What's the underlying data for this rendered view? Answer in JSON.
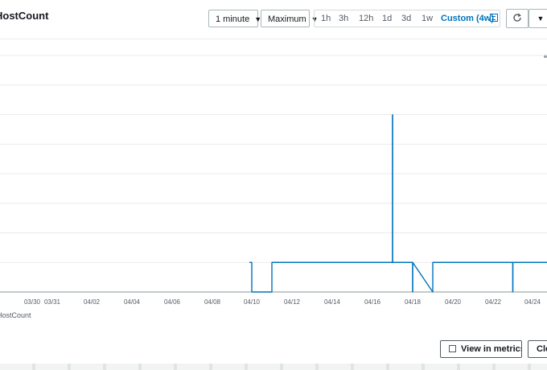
{
  "title": "HostCount",
  "toolbar": {
    "period": "1 minute",
    "statistic": "Maximum",
    "ranges": [
      "1h",
      "3h",
      "12h",
      "1d",
      "3d",
      "1w"
    ],
    "custom_range": "Custom (4w)",
    "refresh_icon": "refresh-icon",
    "calendar_icon": "calendar-icon",
    "menu_icon": "caret-down-icon"
  },
  "footer": {
    "view_in_metrics": "View in metrics",
    "close": "Close"
  },
  "colors": {
    "series": "#0073bb",
    "grid": "#e9ebed",
    "axis": "#879596"
  },
  "chart_data": {
    "type": "line",
    "title": "HostCount",
    "x_tick_labels": [
      "03/30",
      "03/31",
      "04/02",
      "04/04",
      "04/06",
      "04/08",
      "04/10",
      "04/12",
      "04/14",
      "04/16",
      "04/18",
      "04/20",
      "04/22",
      "04/24"
    ],
    "series": [
      {
        "name": "HostCount",
        "segments": [
          {
            "x": "04/10",
            "y": 1
          },
          {
            "x": "04/10",
            "y": 0
          },
          {
            "x": "04/11",
            "y": 0
          },
          {
            "x": "04/11",
            "y": 1
          },
          {
            "x": "04/17",
            "y": 1
          },
          {
            "x": "04/17",
            "y": 6
          },
          {
            "x": "04/17",
            "y": 1
          },
          {
            "x": "04/18",
            "y": 1
          },
          {
            "x": "04/18",
            "y": 0
          },
          {
            "x": "04/18",
            "y": 1
          },
          {
            "x": "04/19",
            "y": 0
          },
          {
            "x": "04/19",
            "y": 1
          },
          {
            "x": "04/23",
            "y": 1
          },
          {
            "x": "04/23",
            "y": 0
          },
          {
            "x": "04/23",
            "y": 1
          },
          {
            "x": "04/25",
            "y": 1
          }
        ]
      }
    ],
    "ylim": [
      0,
      8
    ],
    "grid": true,
    "legend_position": "bottom-left"
  }
}
